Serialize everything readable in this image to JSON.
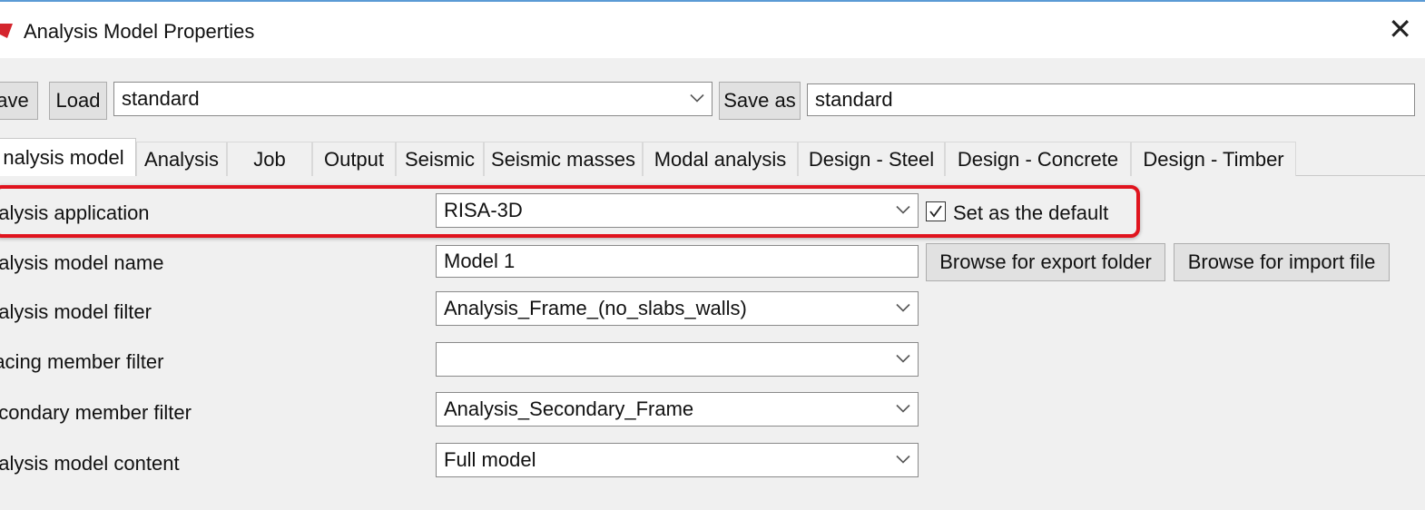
{
  "window": {
    "title": "Analysis Model Properties",
    "icon": "app-icon",
    "close_icon": "close-icon"
  },
  "toolbar": {
    "save_label": "ave",
    "load_label": "Load",
    "settings_value": "standard",
    "save_as_label": "Save as",
    "save_as_value": "standard"
  },
  "tabs": [
    {
      "label": "nalysis model",
      "active": true
    },
    {
      "label": "Analysis"
    },
    {
      "label": "Job"
    },
    {
      "label": "Output"
    },
    {
      "label": "Seismic"
    },
    {
      "label": "Seismic masses"
    },
    {
      "label": "Modal analysis"
    },
    {
      "label": "Design - Steel"
    },
    {
      "label": "Design - Concrete"
    },
    {
      "label": "Design - Timber"
    }
  ],
  "fields": {
    "application": {
      "label": "nalysis application",
      "value": "RISA-3D"
    },
    "default": {
      "label": "Set as the default",
      "checked": true
    },
    "model_name": {
      "label": "nalysis model name",
      "value": "Model 1"
    },
    "browse_export": "Browse for export folder",
    "browse_import": "Browse for import file",
    "model_filter": {
      "label": "nalysis model filter",
      "value": "Analysis_Frame_(no_slabs_walls)"
    },
    "bracing_filter": {
      "label": "racing member filter",
      "value": ""
    },
    "secondary_filter": {
      "label": "econdary member filter",
      "value": "Analysis_Secondary_Frame"
    },
    "model_content": {
      "label": "nalysis model content",
      "value": "Full model"
    }
  },
  "colors": {
    "highlight": "#e0141e",
    "title_border": "#5b9bd5",
    "background": "#f0f0f0"
  }
}
